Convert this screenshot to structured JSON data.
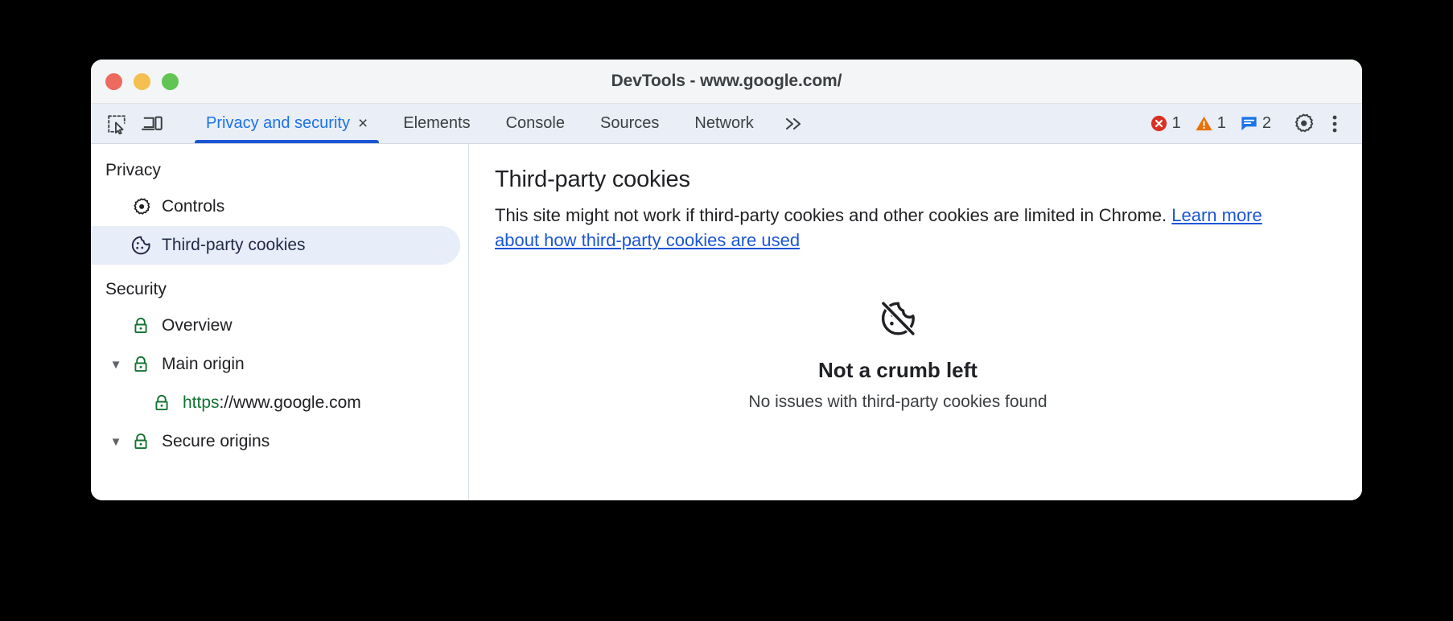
{
  "window": {
    "title": "DevTools - www.google.com/",
    "traffic_lights": [
      {
        "name": "close",
        "color": "#ed6a5e"
      },
      {
        "name": "minimize",
        "color": "#f4bf4f"
      },
      {
        "name": "maximize",
        "color": "#61c454"
      }
    ]
  },
  "toolbar": {
    "inspect_icon": "inspect-element-icon",
    "device_icon": "device-toolbar-icon",
    "tabs": [
      {
        "label": "Privacy and security",
        "active": true,
        "closable": true
      },
      {
        "label": "Elements",
        "active": false,
        "closable": false
      },
      {
        "label": "Console",
        "active": false,
        "closable": false
      },
      {
        "label": "Sources",
        "active": false,
        "closable": false
      },
      {
        "label": "Network",
        "active": false,
        "closable": false
      }
    ],
    "tab_close_glyph": "×",
    "more_tabs_glyph": "»",
    "badges": [
      {
        "name": "errors",
        "icon": "error-icon",
        "count": "1",
        "color": "#d93025"
      },
      {
        "name": "warnings",
        "icon": "warning-icon",
        "count": "1",
        "color": "#e8710a"
      },
      {
        "name": "issues",
        "icon": "issues-icon",
        "count": "2",
        "color": "#1a73e8"
      }
    ],
    "settings_icon": "gear-icon",
    "more_options_icon": "more-vertical-icon"
  },
  "sidebar": {
    "sections": [
      {
        "heading": "Privacy",
        "items": [
          {
            "label": "Controls",
            "icon": "gear-icon",
            "indent": 1,
            "selected": false,
            "twisty": ""
          },
          {
            "label": "Third-party cookies",
            "icon": "cookie-icon",
            "indent": 1,
            "selected": true,
            "twisty": ""
          }
        ]
      },
      {
        "heading": "Security",
        "items": [
          {
            "label": "Overview",
            "icon": "lock-icon",
            "indent": 1,
            "selected": false,
            "twisty": ""
          },
          {
            "label": "Main origin",
            "icon": "lock-icon",
            "indent": 0,
            "selected": false,
            "twisty": "▼"
          },
          {
            "label": "https://www.google.com",
            "icon": "lock-icon",
            "indent": 2,
            "selected": false,
            "twisty": "",
            "scheme": "https",
            "rest": "://www.google.com"
          },
          {
            "label": "Secure origins",
            "icon": "lock-icon",
            "indent": 0,
            "selected": false,
            "twisty": "▼"
          }
        ]
      }
    ]
  },
  "main": {
    "heading": "Third-party cookies",
    "description_before": "This site might not work if third-party cookies and other cookies are limited in Chrome. ",
    "link_text": "Learn more about how third-party cookies are used",
    "empty_state": {
      "icon": "cookie-off-icon",
      "title": "Not a crumb left",
      "subtitle": "No issues with third-party cookies found"
    }
  },
  "colors": {
    "accent_blue": "#1a73e8",
    "tab_underline": "#1a56d6",
    "lock_green": "#137333",
    "selected_bg": "#e8edfa",
    "toolbar_bg": "#eaeef6",
    "titlebar_bg": "#f4f5f6"
  }
}
